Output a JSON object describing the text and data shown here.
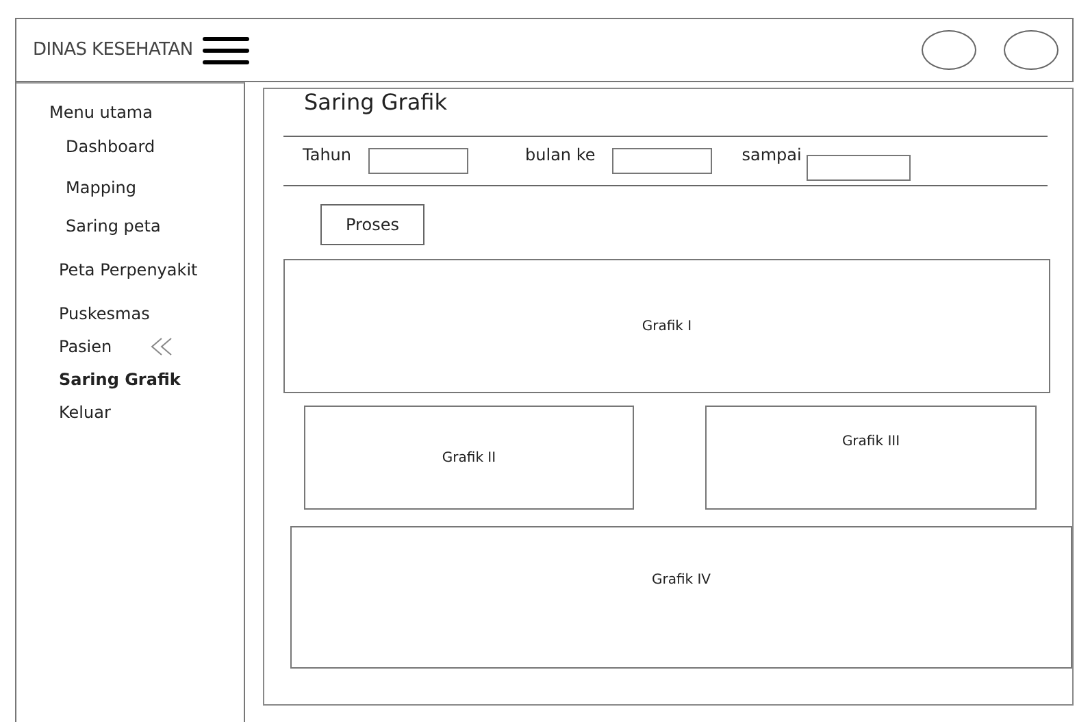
{
  "header": {
    "title": "DINAS KESEHATAN"
  },
  "sidebar": {
    "heading": "Menu utama",
    "items": [
      {
        "label": "Dashboard",
        "kind": "link",
        "selected": false
      },
      {
        "label": "Mapping",
        "kind": "link",
        "selected": false
      },
      {
        "label": "Saring peta",
        "kind": "link",
        "selected": false
      },
      {
        "label": "Peta Perpenyakit",
        "kind": "link",
        "selected": false
      },
      {
        "label": "Puskesmas",
        "kind": "link",
        "selected": false
      },
      {
        "label": "Pasien",
        "kind": "group",
        "selected": false
      },
      {
        "label": "Saring Grafik",
        "kind": "link",
        "selected": true
      },
      {
        "label": "Keluar",
        "kind": "link",
        "selected": false
      }
    ]
  },
  "page": {
    "title": "Saring Grafik",
    "filters": [
      {
        "label": "Tahun"
      },
      {
        "label": "bulan ke"
      },
      {
        "label": "sampai"
      }
    ],
    "button": "Proses",
    "charts": [
      {
        "label": "Grafik I"
      },
      {
        "label": "Grafik II"
      },
      {
        "label": "Grafik III"
      },
      {
        "label": "Grafik IV"
      }
    ]
  }
}
